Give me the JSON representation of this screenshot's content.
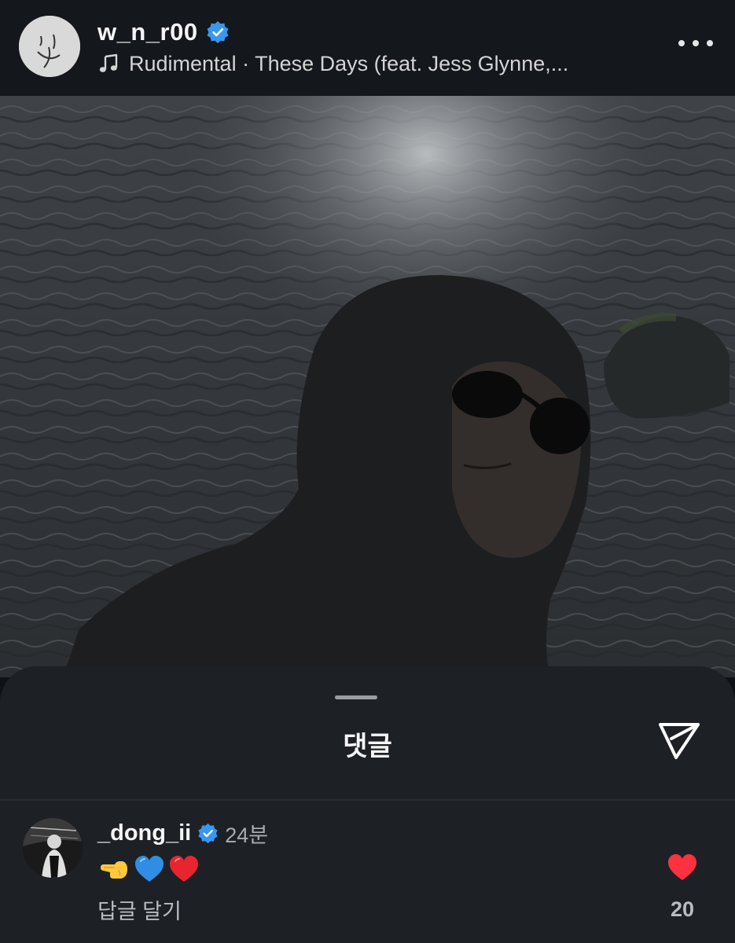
{
  "post": {
    "username": "w_n_r00",
    "music_text": "Rudimental · These Days (feat. Jess Glynne,..."
  },
  "comments_sheet": {
    "title": "댓글"
  },
  "comment": {
    "username": "_dong_ii",
    "time": "24분",
    "emojis": [
      "pointing-hand-emoji",
      "blue-heart-emoji",
      "red-heart-emoji"
    ],
    "reply_label": "답글 달기",
    "like_count": "20"
  },
  "colors": {
    "verified_blue": "#3897f0",
    "like_red": "#ff3040",
    "background": "#0f1114",
    "sheet": "#1d2125"
  }
}
